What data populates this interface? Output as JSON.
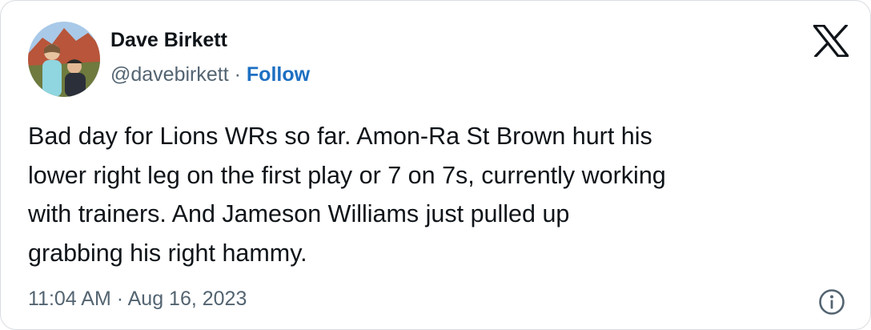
{
  "author": {
    "name": "Dave Birkett",
    "handle": "@davebirkett",
    "separator": "·",
    "follow_label": "Follow",
    "avatar_icon": "profile-photo"
  },
  "tweet": {
    "lines": [
      "Bad day for Lions WRs so far. Amon-Ra St Brown hurt his",
      "lower right leg on the first play or 7 on 7s, currently working",
      "with trainers. And Jameson Williams just pulled up",
      "grabbing his right hammy."
    ]
  },
  "footer": {
    "timestamp": "11:04 AM · Aug 16, 2023",
    "info_icon": "info-icon"
  },
  "colors": {
    "text": "#0f1419",
    "secondary_text": "#536471",
    "follow_link": "#1d6fc2",
    "border": "#d9dde1"
  }
}
